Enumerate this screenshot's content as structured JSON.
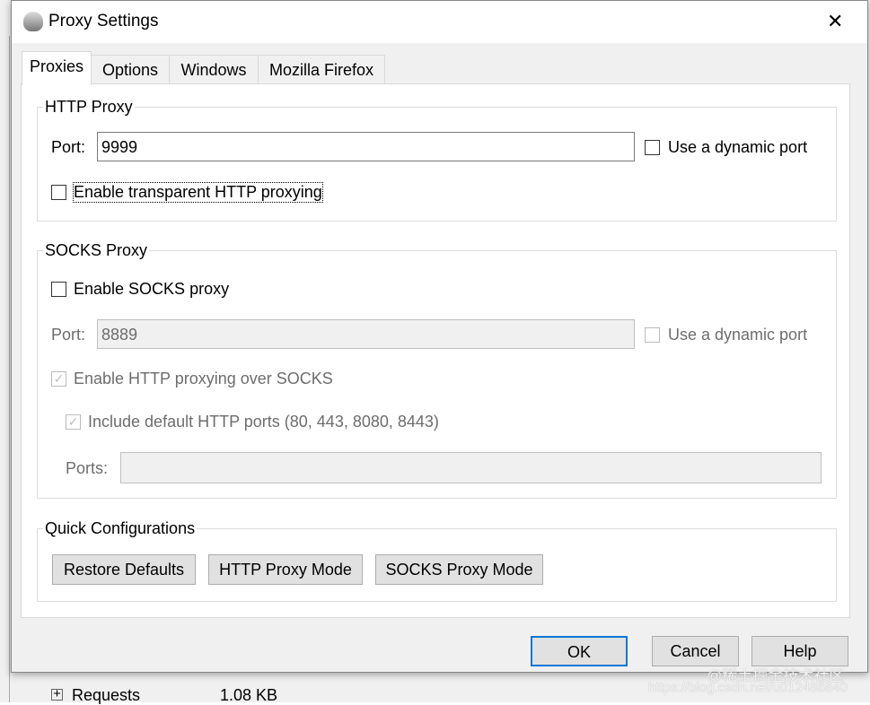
{
  "window": {
    "title": "Proxy Settings",
    "close": "✕"
  },
  "tabs": [
    {
      "label": "Proxies"
    },
    {
      "label": "Options"
    },
    {
      "label": "Windows"
    },
    {
      "label": "Mozilla Firefox"
    }
  ],
  "http_proxy": {
    "legend": "HTTP Proxy",
    "port_label": "Port:",
    "port_value": "9999",
    "dynamic_port_label": "Use a dynamic port",
    "dynamic_port_checked": false,
    "transparent_label": "Enable transparent HTTP proxying",
    "transparent_checked": false
  },
  "socks_proxy": {
    "legend": "SOCKS Proxy",
    "enable_label": "Enable SOCKS proxy",
    "enable_checked": false,
    "port_label": "Port:",
    "port_value": "8889",
    "dynamic_port_label": "Use a dynamic port",
    "http_over_socks_label": "Enable HTTP proxying over SOCKS",
    "http_over_socks_checked": true,
    "include_ports_label": "Include default HTTP ports (80, 443, 8080, 8443)",
    "include_ports_checked": true,
    "ports_label": "Ports:",
    "ports_value": ""
  },
  "quick": {
    "legend": "Quick Configurations",
    "buttons": [
      "Restore Defaults",
      "HTTP Proxy Mode",
      "SOCKS Proxy Mode"
    ]
  },
  "footer": {
    "ok": "OK",
    "cancel": "Cancel",
    "help": "Help"
  },
  "background": {
    "tree_item": "Requests",
    "tree_size": "1.08 KB"
  },
  "watermark": {
    "line1": "@稀土掘金技术社区",
    "line2": "https://blog.csdn.net/u012486840"
  }
}
